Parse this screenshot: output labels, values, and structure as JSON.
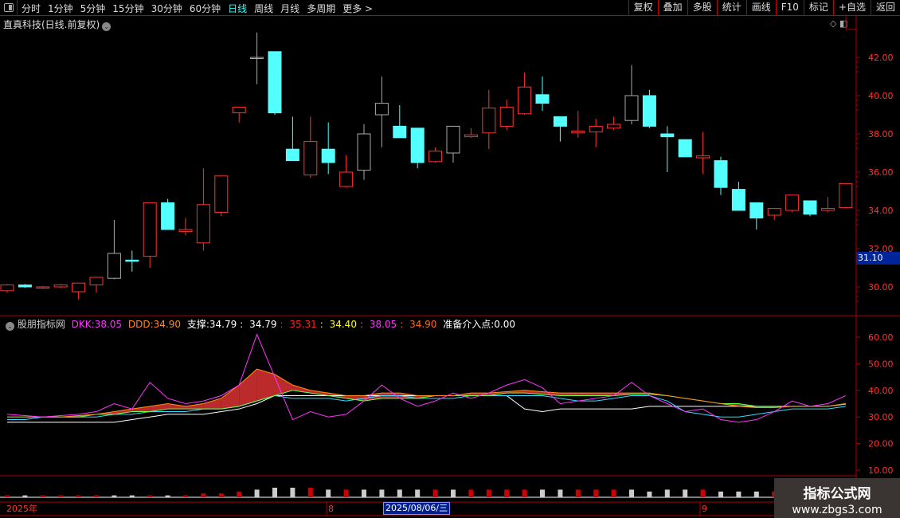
{
  "toolbar": {
    "periods": [
      "分时",
      "1分钟",
      "5分钟",
      "15分钟",
      "30分钟",
      "60分钟",
      "日线",
      "周线",
      "月线",
      "多周期",
      "更多 >"
    ],
    "active": "日线",
    "buttons": [
      "复权",
      "叠加",
      "多股",
      "统计",
      "画线",
      "F10",
      "标记",
      "+自选",
      "返回"
    ]
  },
  "title": "直真科技(日线.前复权)",
  "price_axis": [
    "42.00",
    "40.00",
    "38.00",
    "36.00",
    "34.00",
    "32.00",
    "30.00"
  ],
  "current_price": "31.10",
  "indicator": {
    "name": "股朋指标网",
    "dkk_label": "DKK:",
    "dkk": "38.05",
    "ddd_label": "DDD:",
    "ddd": "34.90",
    "zc_label": "支撑:",
    "zc": [
      "34.79",
      "34.79",
      "35.31",
      "34.40",
      "38.05",
      "34.90"
    ],
    "entry_label": "准备介入点:",
    "entry": "0.00",
    "axis": [
      "60.00",
      "50.00",
      "40.00",
      "30.00",
      "20.00",
      "10.00"
    ]
  },
  "time_axis": {
    "year": "2025年",
    "m8": "8",
    "cursor": "2025/08/06/三",
    "m9": "9"
  },
  "watermark": {
    "name": "指标公式网",
    "url": "www.zbgs3.com"
  },
  "colors": {
    "up": "#ff3232",
    "down": "#54ffff",
    "neutral": "#aaaaaa",
    "dkk": "#ff33ff",
    "ddd": "#ff8c1a",
    "support": "#ffffff",
    "grid": "#b00000"
  },
  "chart_data": {
    "type": "candlestick",
    "ohlc": [
      [
        29.8,
        30.1,
        30.15,
        29.7,
        "u"
      ],
      [
        30.1,
        30.0,
        30.15,
        29.95,
        "d"
      ],
      [
        29.95,
        30.0,
        30.05,
        29.9,
        "u"
      ],
      [
        30.0,
        30.1,
        30.15,
        29.95,
        "u"
      ],
      [
        29.75,
        30.2,
        30.2,
        29.35,
        "u"
      ],
      [
        30.1,
        30.5,
        30.5,
        29.7,
        "u"
      ],
      [
        30.45,
        31.75,
        33.5,
        30.4,
        "n"
      ],
      [
        31.4,
        31.4,
        31.9,
        30.8,
        "d"
      ],
      [
        31.6,
        34.4,
        34.4,
        31.0,
        "u"
      ],
      [
        34.4,
        33.0,
        34.6,
        33.0,
        "d"
      ],
      [
        32.9,
        33.0,
        33.6,
        32.7,
        "u"
      ],
      [
        32.3,
        34.3,
        36.2,
        31.9,
        "u"
      ],
      [
        33.9,
        35.8,
        35.8,
        33.7,
        "u"
      ],
      [
        39.1,
        39.4,
        39.4,
        38.6,
        "u"
      ],
      [
        42.0,
        42.0,
        43.3,
        40.6,
        "n"
      ],
      [
        42.3,
        39.1,
        42.3,
        39.0,
        "d"
      ],
      [
        37.2,
        36.6,
        38.9,
        36.6,
        "d"
      ],
      [
        35.85,
        37.6,
        38.9,
        35.7,
        "u"
      ],
      [
        37.2,
        36.5,
        38.6,
        35.9,
        "d"
      ],
      [
        35.25,
        36.0,
        36.9,
        35.2,
        "u"
      ],
      [
        36.1,
        38.0,
        38.5,
        35.6,
        "n"
      ],
      [
        39.0,
        39.6,
        41.0,
        37.3,
        "n"
      ],
      [
        38.4,
        37.8,
        39.5,
        37.8,
        "d"
      ],
      [
        38.3,
        36.5,
        38.3,
        36.2,
        "d"
      ],
      [
        36.55,
        37.1,
        37.3,
        36.5,
        "u"
      ],
      [
        37.0,
        38.4,
        38.4,
        36.5,
        "n"
      ],
      [
        37.85,
        37.95,
        38.3,
        37.8,
        "u"
      ],
      [
        38.05,
        39.35,
        40.3,
        37.2,
        "u"
      ],
      [
        38.4,
        39.4,
        39.8,
        38.2,
        "u"
      ],
      [
        39.05,
        40.45,
        41.2,
        39.0,
        "u"
      ],
      [
        40.05,
        39.6,
        41.0,
        39.2,
        "d"
      ],
      [
        38.9,
        38.4,
        38.9,
        37.6,
        "d"
      ],
      [
        38.05,
        38.15,
        39.2,
        37.8,
        "u"
      ],
      [
        38.1,
        38.4,
        38.8,
        37.3,
        "u"
      ],
      [
        38.3,
        38.5,
        38.9,
        38.2,
        "u"
      ],
      [
        38.7,
        40.0,
        41.6,
        38.5,
        "n"
      ],
      [
        40.0,
        38.4,
        40.3,
        38.3,
        "d"
      ],
      [
        38.0,
        37.85,
        38.4,
        36.0,
        "d"
      ],
      [
        37.7,
        36.8,
        37.7,
        36.8,
        "d"
      ],
      [
        36.75,
        36.85,
        38.1,
        35.9,
        "u"
      ],
      [
        36.6,
        35.2,
        36.8,
        34.8,
        "d"
      ],
      [
        35.1,
        34.0,
        35.5,
        34.0,
        "d"
      ],
      [
        34.4,
        33.6,
        34.4,
        33.0,
        "d"
      ],
      [
        33.75,
        34.1,
        34.1,
        33.5,
        "u"
      ],
      [
        34.0,
        34.8,
        34.8,
        33.9,
        "u"
      ],
      [
        34.5,
        33.8,
        34.5,
        33.7,
        "d"
      ],
      [
        34.0,
        34.1,
        34.7,
        33.9,
        "u"
      ],
      [
        34.15,
        35.4,
        35.4,
        34.1,
        "u"
      ]
    ],
    "price_range": [
      29,
      43.5
    ],
    "dkk": [
      31,
      30.5,
      30,
      30.5,
      31,
      32,
      35,
      33,
      43,
      37,
      35,
      36,
      38,
      42,
      61,
      45,
      29,
      32,
      30,
      31,
      36,
      42,
      37,
      34,
      36,
      39,
      37,
      39,
      42,
      44,
      41,
      35,
      36,
      37,
      38,
      43,
      38,
      35,
      32,
      33,
      29,
      28,
      29,
      32,
      36,
      34,
      35,
      38
    ],
    "ddd": [
      30,
      30,
      30,
      30,
      30.5,
      31,
      32,
      33,
      34,
      35,
      34,
      35,
      37,
      42,
      48,
      46,
      42,
      40,
      39,
      38,
      38,
      39,
      39,
      38,
      38,
      38,
      39,
      39,
      39.5,
      40,
      39.5,
      39,
      39,
      39,
      39,
      39,
      39,
      38,
      37,
      36,
      35,
      34,
      33.5,
      33.5,
      34,
      34,
      34,
      35
    ],
    "support": [
      28,
      28,
      28,
      28,
      28,
      28,
      28,
      29,
      30,
      31,
      31,
      31,
      32,
      33,
      35,
      38,
      38,
      38,
      38,
      38,
      38,
      38,
      38,
      38,
      38,
      38,
      38,
      38,
      38,
      33,
      32,
      33,
      33,
      33,
      33,
      33,
      34,
      34,
      34,
      34,
      34,
      34,
      34,
      34,
      34,
      34,
      34,
      34.8
    ],
    "line_green": [
      30,
      30,
      30,
      30,
      30,
      31,
      31,
      32,
      32,
      33,
      33,
      33,
      33,
      34,
      36,
      38,
      40,
      39,
      38,
      37,
      36,
      37,
      37,
      37,
      38,
      38,
      38,
      38,
      39,
      39,
      38.5,
      38,
      38,
      38,
      38,
      38.5,
      38.5,
      38,
      37,
      36,
      35,
      35,
      34,
      34,
      34,
      34,
      34,
      35
    ],
    "line_cyan": [
      29,
      29,
      30,
      30,
      30,
      30,
      31,
      31,
      32,
      32,
      32,
      33,
      33,
      34,
      36,
      38,
      37,
      37,
      37,
      36,
      37,
      38,
      38,
      37,
      37,
      37,
      38,
      38,
      38,
      38,
      38,
      37,
      36,
      36,
      37,
      38,
      38,
      36,
      32,
      31,
      30,
      30,
      31,
      32,
      33,
      33,
      33,
      34
    ],
    "indicator_range": [
      5,
      65
    ],
    "volume": [
      1,
      1,
      1,
      1,
      1,
      1,
      1,
      1,
      1,
      1,
      1,
      2,
      2,
      3,
      4,
      5,
      5,
      5,
      4,
      4,
      4,
      4,
      4,
      4,
      4,
      4,
      4,
      4,
      4,
      4,
      4,
      4,
      4,
      4,
      4,
      4,
      3,
      4,
      4,
      4,
      3,
      3,
      3,
      3,
      2,
      2,
      1,
      0
    ]
  }
}
